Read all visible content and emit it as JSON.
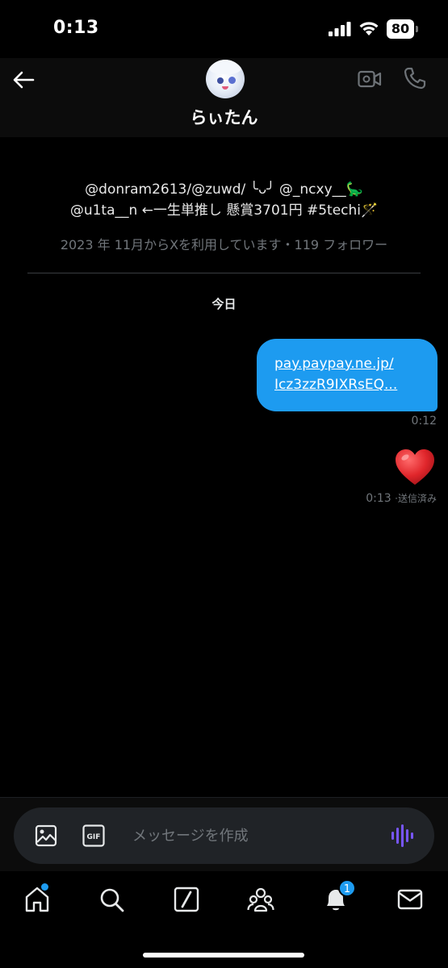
{
  "status_bar": {
    "time": "0:13",
    "battery": "80"
  },
  "header": {
    "name": "らぃたん",
    "icons": [
      "back-arrow-icon",
      "avatar",
      "video-camera-icon",
      "phone-icon"
    ]
  },
  "profile": {
    "bio_line1": "@donram2613/@zuwd/ ╰ᴗ╯ @_ncxy__🦕",
    "bio_line2": "@u1ta__n ←一生単推し 懸賞3701円 #5techi🪄",
    "meta": "2023 年 11月からXを利用しています・119 フォロワー"
  },
  "conversation": {
    "date_label": "今日",
    "messages": [
      {
        "type": "link",
        "line1": "pay.paypay.ne.jp/",
        "line2": "Icz3zzR9IXRsEQ...",
        "time": "0:12"
      },
      {
        "type": "emoji",
        "emoji": "❤️",
        "time": "0:13",
        "status": "·送信済み"
      }
    ]
  },
  "composer": {
    "placeholder": "メッセージを作成",
    "gif_label": "GIF"
  },
  "tab_bar": {
    "items": [
      "home-icon",
      "search-icon",
      "grok-icon",
      "communities-icon",
      "notifications-icon",
      "messages-icon"
    ],
    "notification_count": "1",
    "accent": "#1d9bf0"
  }
}
